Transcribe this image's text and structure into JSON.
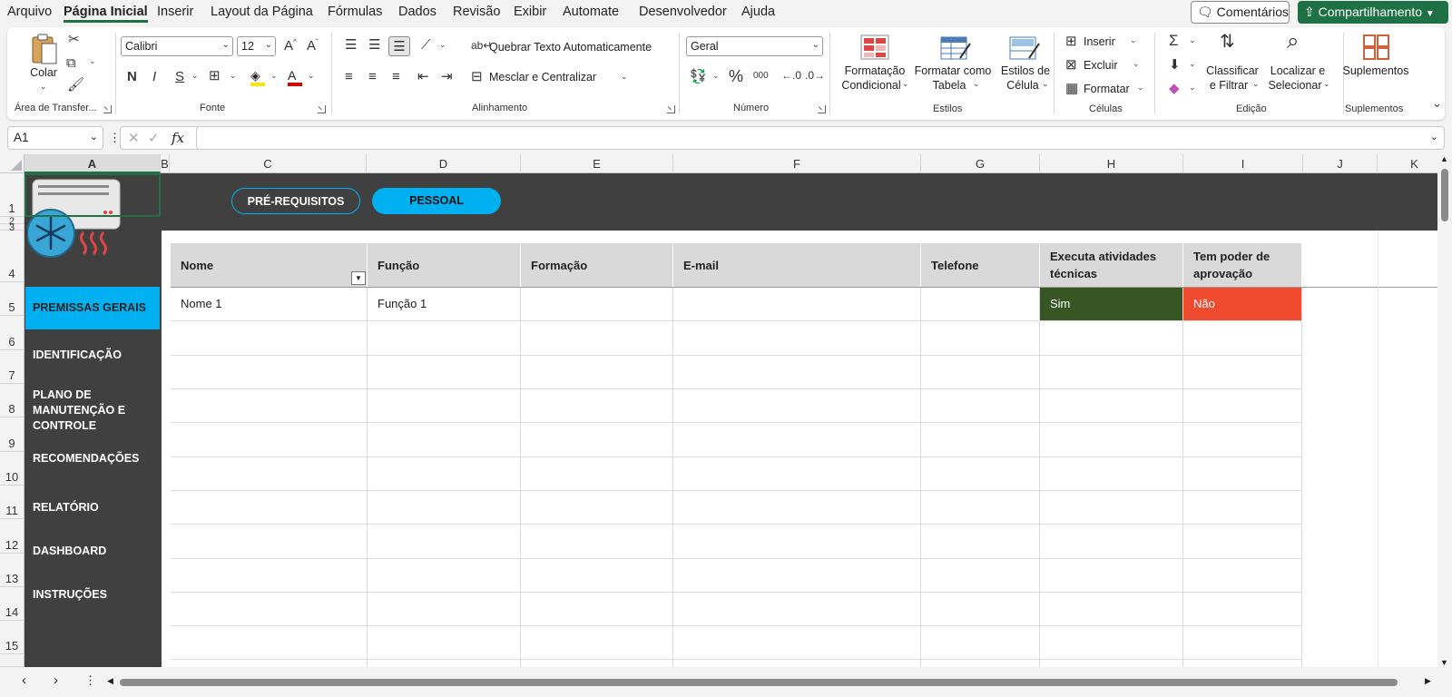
{
  "menu": {
    "tabs": [
      "Arquivo",
      "Página Inicial",
      "Inserir",
      "Layout da Página",
      "Fórmulas",
      "Dados",
      "Revisão",
      "Exibir",
      "Automate",
      "Desenvolvedor",
      "Ajuda"
    ],
    "comments": "Comentários",
    "share": "Compartilhamento"
  },
  "ribbon": {
    "clipboard": {
      "paste": "Colar",
      "group": "Área de Transfer..."
    },
    "font": {
      "name": "Calibri",
      "size": "12",
      "bold": "N",
      "italic": "I",
      "underline": "S",
      "group": "Fonte"
    },
    "alignment": {
      "wrap": "Quebrar Texto Automaticamente",
      "merge": "Mesclar e Centralizar",
      "group": "Alinhamento"
    },
    "number": {
      "format": "Geral",
      "percent": "%",
      "thousands": "000",
      "group": "Número"
    },
    "styles": {
      "conditional1": "Formatação",
      "conditional2": "Condicional",
      "table1": "Formatar como",
      "table2": "Tabela",
      "cell1": "Estilos de",
      "cell2": "Célula",
      "group": "Estilos"
    },
    "cells": {
      "insert": "Inserir",
      "delete": "Excluir",
      "format": "Formatar",
      "group": "Células"
    },
    "editing": {
      "sort1": "Classificar",
      "sort2": "e Filtrar",
      "find1": "Localizar e",
      "find2": "Selecionar",
      "group": "Edição"
    },
    "addins": {
      "label": "Suplementos",
      "group": "Suplementos"
    }
  },
  "formula": {
    "namebox": "A1",
    "fx": "fx",
    "value": ""
  },
  "columns": [
    "A",
    "B",
    "C",
    "D",
    "E",
    "F",
    "G",
    "H",
    "I",
    "J",
    "K"
  ],
  "rows": [
    "1",
    "2",
    "3",
    "4",
    "5",
    "6",
    "7",
    "8",
    "9",
    "10",
    "11",
    "12",
    "13",
    "14",
    "15"
  ],
  "sheet": {
    "tabs": {
      "prereq": "PRÉ-REQUISITOS",
      "pessoal": "PESSOAL"
    },
    "nav": [
      "PREMISSAS GERAIS",
      "IDENTIFICAÇÃO",
      "PLANO DE MANUTENÇÃO E CONTROLE",
      "RECOMENDAÇÕES",
      "RELATÓRIO",
      "DASHBOARD",
      "INSTRUÇÕES"
    ],
    "headers": [
      "Nome",
      "Função",
      "Formação",
      "E-mail",
      "Telefone",
      "Executa atividades técnicas",
      "Tem poder de aprovação"
    ],
    "rows": [
      [
        "Nome 1",
        "Função 1",
        "",
        "",
        "",
        "Sim",
        "Não"
      ]
    ],
    "colors": {
      "dark": "#404040",
      "accent": "#00b0f0",
      "yes": "#375623",
      "no": "#f04a2f"
    }
  }
}
